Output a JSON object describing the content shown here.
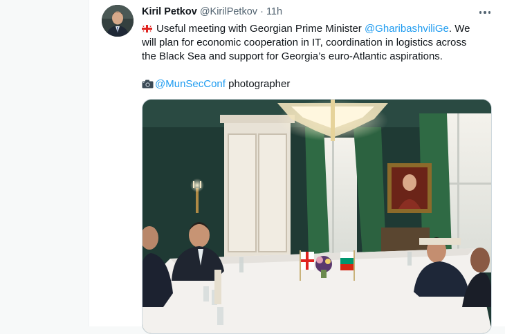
{
  "tweet": {
    "author_name": "Kiril Petkov",
    "author_handle": "@KirilPetkov",
    "separator": "·",
    "time": "11h",
    "more_icon": "more-horizontal-icon",
    "text_part1": "Useful meeting with Georgian Prime Minister ",
    "mention1": "@GharibashviliGe",
    "text_part2": ". We will plan for economic cooperation in IT, coordination in logistics across the Black Sea and support for Georgia’s euro-Atlantic aspirations.",
    "mention2": "@MunSecConf",
    "credit_suffix": " photographer",
    "flag_icon": "georgia-flag-icon",
    "camera_icon": "camera-icon"
  },
  "colors": {
    "link": "#1d9bf0",
    "text": "#0f1419",
    "secondary": "#536471"
  }
}
